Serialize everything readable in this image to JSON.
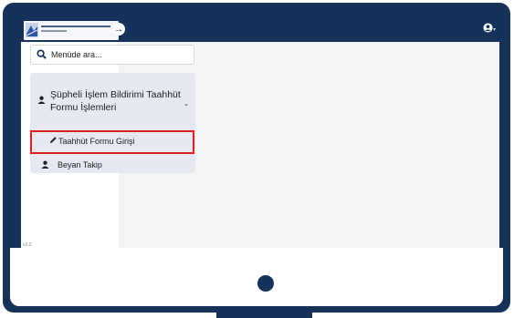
{
  "app": {
    "logo_org": "Mali Suçları Araştırma Kurulu",
    "collapse_symbol": "→",
    "user_icon": "user-circle-icon"
  },
  "sidebar": {
    "search": {
      "placeholder": "Menüde ara..."
    },
    "group": {
      "icon": "person-icon",
      "title": "Şüpheli İşlem Bildirimi Taahhüt Formu İşlemleri",
      "expanded": true
    },
    "items": [
      {
        "label": "Taahhüt Formu Girişi",
        "icon": "pencil-icon",
        "highlighted": true
      },
      {
        "label": "Beyan Takip",
        "icon": "person-icon",
        "highlighted": false
      }
    ]
  },
  "footer": {
    "version": "v3.0"
  },
  "colors": {
    "brand_navy": "#15335a",
    "highlight_red": "#e51c23",
    "panel_bg": "#e7e9f2"
  }
}
